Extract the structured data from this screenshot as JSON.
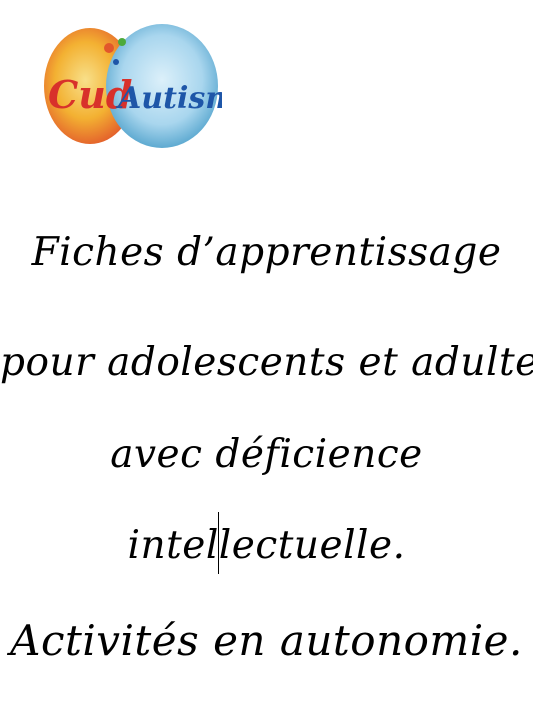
{
  "logo": {
    "text_left": "Cud",
    "text_right": "Autisme",
    "colors": {
      "left_blob": "#f3b132",
      "left_blob_edge": "#e2572b",
      "right_blob": "#a9d6ee",
      "right_blob_edge": "#4a9ec9",
      "text_red": "#d8312b",
      "text_blue": "#1e56a8",
      "dots": [
        "#4caa3b",
        "#e2572b",
        "#1e56a8"
      ]
    }
  },
  "title": {
    "line1": "Fiches d’apprentissage",
    "line2": "pour adolescents et adultes",
    "line3": "avec déficience",
    "line4": "intellectuelle.",
    "line5": "Activités en autonomie."
  }
}
